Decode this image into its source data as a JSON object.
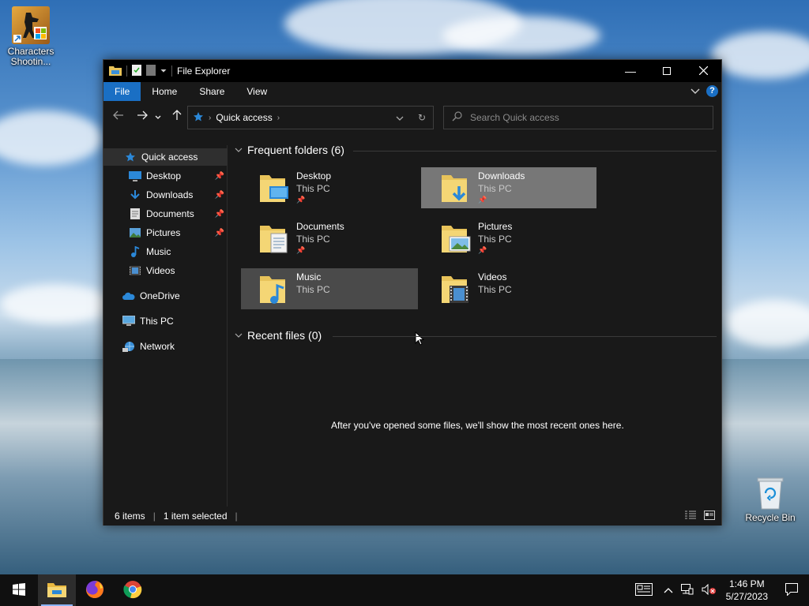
{
  "desktop": {
    "icons": [
      {
        "label": "Characters Shootin..."
      },
      {
        "label": "Recycle Bin"
      }
    ]
  },
  "window": {
    "title": "File Explorer",
    "ribbon_tabs": [
      "File",
      "Home",
      "Share",
      "View"
    ],
    "address": {
      "crumb": "Quick access"
    },
    "search": {
      "placeholder": "Search Quick access"
    }
  },
  "navpane": {
    "items": [
      {
        "label": "Quick access",
        "icon": "star-icon"
      },
      {
        "label": "Desktop",
        "icon": "desktop-icon",
        "pinned": true
      },
      {
        "label": "Downloads",
        "icon": "download-icon",
        "pinned": true
      },
      {
        "label": "Documents",
        "icon": "document-icon",
        "pinned": true
      },
      {
        "label": "Pictures",
        "icon": "pictures-icon",
        "pinned": true
      },
      {
        "label": "Music",
        "icon": "music-icon"
      },
      {
        "label": "Videos",
        "icon": "videos-icon"
      },
      {
        "label": "OneDrive",
        "icon": "cloud-icon"
      },
      {
        "label": "This PC",
        "icon": "computer-icon"
      },
      {
        "label": "Network",
        "icon": "network-icon"
      }
    ]
  },
  "content": {
    "frequent_header": "Frequent folders (6)",
    "recent_header": "Recent files (0)",
    "empty_message": "After you've opened some files, we'll show the most recent ones here.",
    "folders": [
      {
        "name": "Desktop",
        "location": "This PC",
        "pinned": true
      },
      {
        "name": "Downloads",
        "location": "This PC",
        "pinned": true
      },
      {
        "name": "Documents",
        "location": "This PC",
        "pinned": true
      },
      {
        "name": "Pictures",
        "location": "This PC",
        "pinned": true
      },
      {
        "name": "Music",
        "location": "This PC",
        "pinned": false
      },
      {
        "name": "Videos",
        "location": "This PC",
        "pinned": false
      }
    ]
  },
  "statusbar": {
    "items_count": "6 items",
    "selected": "1 item selected"
  },
  "taskbar": {
    "time": "1:46 PM",
    "date": "5/27/2023"
  },
  "colors": {
    "accent": "#1a6fc4",
    "window_bg": "#191919",
    "titlebar_bg": "#000000",
    "taskbar_bg": "#101010"
  }
}
